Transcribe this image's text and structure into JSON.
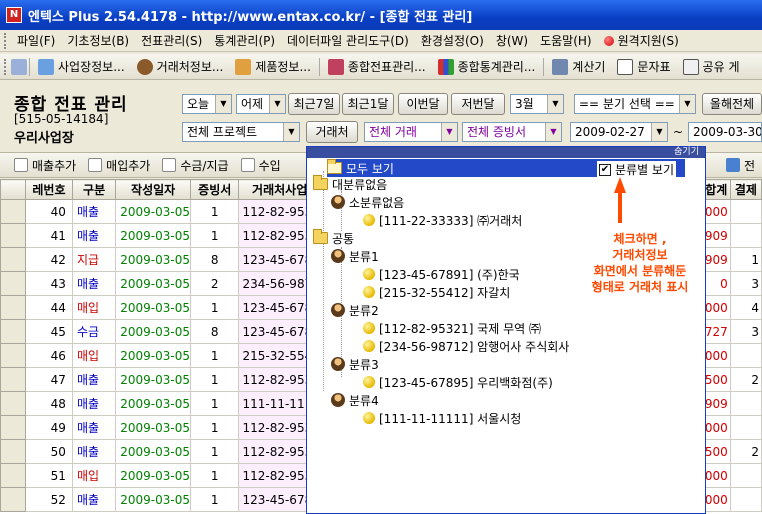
{
  "window": {
    "title": "엔텍스 Plus 2.54.4178 - http://www.entax.co.kr/ - [종합 전표 관리]",
    "icon": "N"
  },
  "menu": [
    "파일(F)",
    "기초정보(B)",
    "전표관리(S)",
    "통계관리(P)",
    "데이터파일 관리도구(D)",
    "환경설정(O)",
    "창(W)",
    "도움말(H)"
  ],
  "menu_remote": "원격지원(S)",
  "shortcuts": [
    "사업장정보...",
    "거래처정보...",
    "제품정보...",
    "종합전표관리...",
    "종합통계관리...",
    "계산기",
    "문자표",
    "공유 게"
  ],
  "header": {
    "title": "종합 전표 관리",
    "biz_no": "[515-05-14184]",
    "biz_name": "우리사업장",
    "today": "오늘",
    "yesterday": "어제",
    "last7": "최근7일",
    "last1m": "최근1달",
    "this_month": "이번달",
    "last_month": "저번달",
    "month_select": "3월",
    "quarter_select": "== 분기 선택 ==",
    "this_year": "올해전체",
    "project": "전체 프로젝트",
    "vendor_btn": "거래처",
    "deal": "전체 거래",
    "evidence": "전체 증빙서",
    "date_from": "2009-02-27",
    "tilde": "~",
    "date_to": "2009-03-30"
  },
  "actions": [
    "매출추가",
    "매입추가",
    "수금/지급",
    "수입"
  ],
  "actions_right": "전",
  "grid": {
    "headers": [
      "레번호",
      "구분",
      "작성일자",
      "증빙서",
      "거래처사업",
      "합계",
      "결제"
    ],
    "rows": [
      {
        "no": "40",
        "type": "매출",
        "date": "2009-03-05",
        "cnt": "1",
        "vendor": "112-82-9532",
        "amt": "000",
        "pay": ""
      },
      {
        "no": "41",
        "type": "매출",
        "date": "2009-03-05",
        "cnt": "1",
        "vendor": "112-82-9532",
        "amt": "909",
        "pay": ""
      },
      {
        "no": "42",
        "type": "지급",
        "date": "2009-03-05",
        "cnt": "8",
        "vendor": "123-45-6789",
        "amt": "909",
        "pay": "1"
      },
      {
        "no": "43",
        "type": "매출",
        "date": "2009-03-05",
        "cnt": "2",
        "vendor": "234-56-9871",
        "amt": "0",
        "pay": "3"
      },
      {
        "no": "44",
        "type": "매입",
        "date": "2009-03-05",
        "cnt": "1",
        "vendor": "123-45-6789",
        "amt": "000",
        "pay": "4"
      },
      {
        "no": "45",
        "type": "수금",
        "date": "2009-03-05",
        "cnt": "8",
        "vendor": "123-45-6789",
        "amt": "727",
        "pay": "3"
      },
      {
        "no": "46",
        "type": "매입",
        "date": "2009-03-05",
        "cnt": "1",
        "vendor": "215-32-5541",
        "amt": "000",
        "pay": ""
      },
      {
        "no": "47",
        "type": "매출",
        "date": "2009-03-05",
        "cnt": "1",
        "vendor": "112-82-9532",
        "amt": "500",
        "pay": "2"
      },
      {
        "no": "48",
        "type": "매출",
        "date": "2009-03-05",
        "cnt": "1",
        "vendor": "111-11-1111",
        "amt": "909",
        "pay": ""
      },
      {
        "no": "49",
        "type": "매출",
        "date": "2009-03-05",
        "cnt": "1",
        "vendor": "112-82-9532",
        "amt": "000",
        "pay": ""
      },
      {
        "no": "50",
        "type": "매출",
        "date": "2009-03-05",
        "cnt": "1",
        "vendor": "112-82-9532",
        "amt": "500",
        "pay": "2"
      },
      {
        "no": "51",
        "type": "매입",
        "date": "2009-03-05",
        "cnt": "1",
        "vendor": "112-82-9532",
        "amt": "000",
        "pay": ""
      },
      {
        "no": "52",
        "type": "매출",
        "date": "2009-03-05",
        "cnt": "1",
        "vendor": "123-45-6789",
        "amt": "000",
        "pay": ""
      }
    ]
  },
  "popup": {
    "hide": "숨기기",
    "show_all": "모두 보기",
    "show_by_category": "분류별 보기",
    "checked": "✔",
    "tree": {
      "major_none": "대분류없음",
      "minor_none": "소분류없음",
      "v1": "[111-22-33333] ㈜거래처",
      "common": "공통",
      "c1": "분류1",
      "c1a": "[123-45-67891] (주)한국",
      "c1b": "[215-32-55412] 자갈치",
      "c2": "분류2",
      "c2a": "[112-82-95321] 국제 무역 ㈜",
      "c2b": "[234-56-98712] 암행어사 주식회사",
      "c3": "분류3",
      "c3a": "[123-45-67895] 우리백화점(주)",
      "c4": "분류4",
      "c4a": "[111-11-11111] 서울시청"
    },
    "annotation": [
      "체크하면 ,",
      "거래처정보",
      "화면에서 분류해둔",
      "형태로 거래처 표시"
    ]
  },
  "colors": {
    "titlebar": "#0a3fc4",
    "sales": "#0000c8",
    "purchase": "#d00000",
    "date": "#008000",
    "annotation": "#ff4a00",
    "tree_selected": "#2449c8"
  }
}
